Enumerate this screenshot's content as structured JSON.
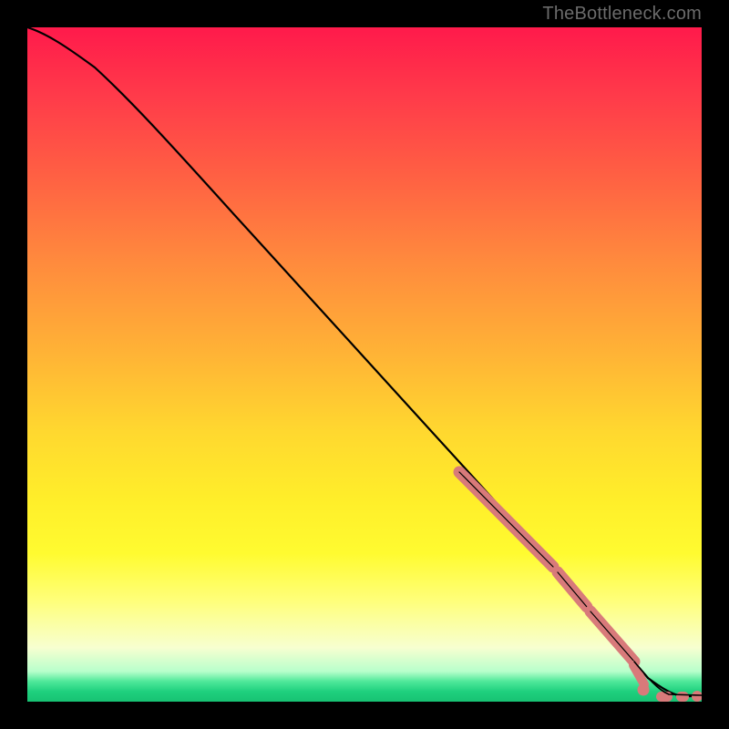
{
  "watermark": "TheBottleneck.com",
  "chart_data": {
    "type": "line",
    "title": "",
    "xlabel": "",
    "ylabel": "",
    "xlim": [
      0,
      100
    ],
    "ylim": [
      0,
      100
    ],
    "series": [
      {
        "name": "curve",
        "x": [
          0,
          3,
          6,
          10,
          15,
          20,
          30,
          40,
          50,
          60,
          70,
          80,
          85,
          88,
          90,
          92,
          95,
          97,
          98,
          99,
          100
        ],
        "y": [
          100,
          99,
          97,
          94,
          89.5,
          84,
          73,
          62,
          51,
          40,
          29,
          18,
          12,
          8.5,
          6,
          4,
          1.8,
          0.8,
          0.5,
          0.5,
          0.5
        ]
      }
    ],
    "markers": [
      {
        "name": "dense-segment-1",
        "x_range": [
          64,
          78
        ],
        "y_range": [
          34,
          20
        ],
        "style": "thick-pink"
      },
      {
        "name": "dense-segment-2",
        "x_range": [
          78,
          83
        ],
        "y_range": [
          20,
          14
        ],
        "style": "thick-pink"
      },
      {
        "name": "dense-segment-3",
        "x_range": [
          83,
          90
        ],
        "y_range": [
          14,
          6
        ],
        "style": "thick-pink"
      },
      {
        "name": "flat-dot-1",
        "x": 91,
        "y": 1.5,
        "style": "pink-dot"
      },
      {
        "name": "flat-dot-2",
        "x": 94,
        "y": 0.6,
        "style": "pink-dash"
      },
      {
        "name": "flat-dot-3",
        "x": 97,
        "y": 0.6,
        "style": "pink-dash"
      },
      {
        "name": "flat-dot-4",
        "x": 99.3,
        "y": 0.6,
        "style": "pink-dot"
      }
    ],
    "gradient_stops": [
      {
        "pos": 0,
        "color": "#ff1a4b"
      },
      {
        "pos": 50,
        "color": "#ffb236"
      },
      {
        "pos": 78,
        "color": "#fffb30"
      },
      {
        "pos": 97,
        "color": "#4fe89a"
      },
      {
        "pos": 100,
        "color": "#17c273"
      }
    ]
  }
}
